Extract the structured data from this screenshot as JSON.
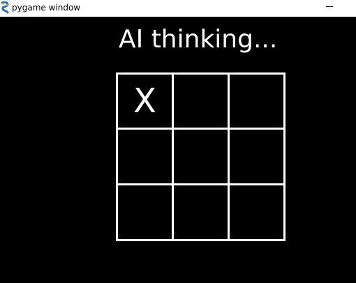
{
  "window": {
    "title": "pygame window",
    "icon": "pygame-snake-icon",
    "controls": [
      "minimize-icon"
    ]
  },
  "game": {
    "status": "AI thinking...",
    "board": [
      [
        "X",
        "",
        ""
      ],
      [
        "",
        "",
        ""
      ],
      [
        "",
        "",
        ""
      ]
    ]
  },
  "colors": {
    "background": "#000000",
    "foreground": "#ffffff",
    "titlebar": "#ffffff"
  }
}
